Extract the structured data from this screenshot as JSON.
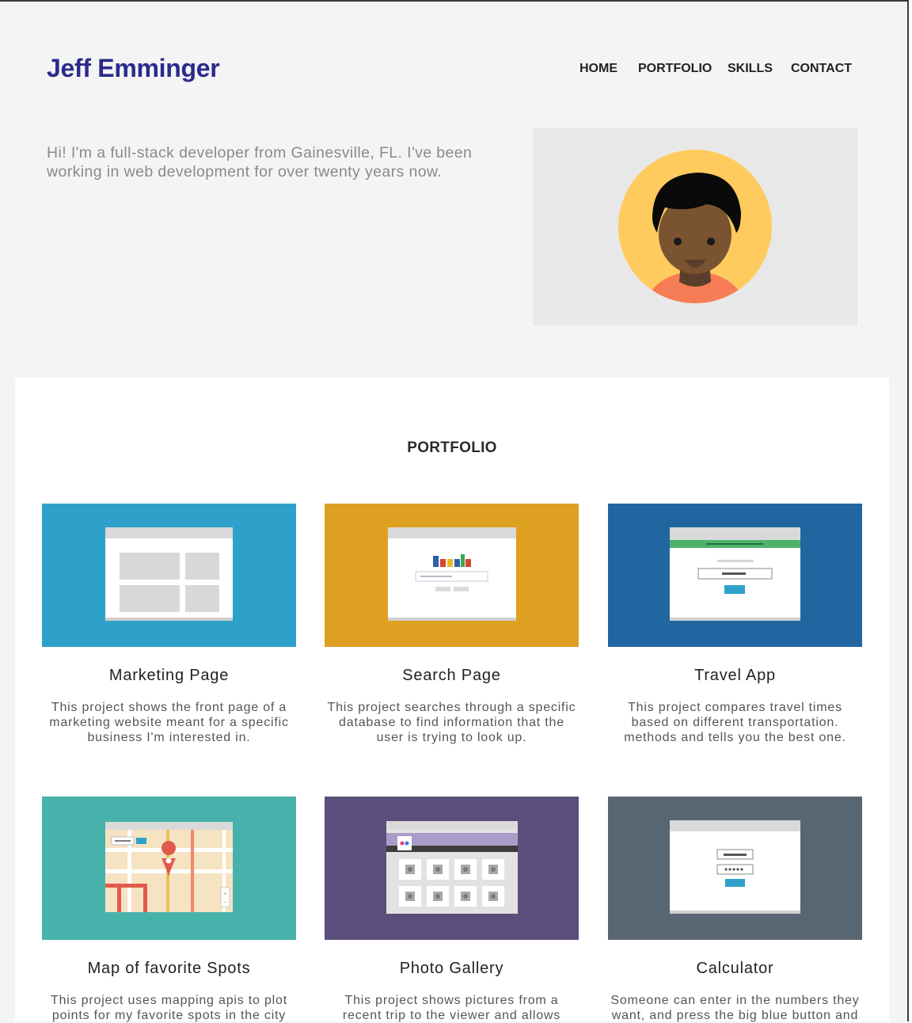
{
  "header": {
    "brand": "Jeff Emminger",
    "nav": [
      {
        "label": "HOME"
      },
      {
        "label": "PORTFOLIO"
      },
      {
        "label": "SKILLS"
      },
      {
        "label": "CONTACT"
      }
    ]
  },
  "hero": {
    "intro": "Hi! I'm a full-stack developer from Gainesville, FL. I've been working in web development for over twenty years now.",
    "avatar_icon": "person-avatar-icon"
  },
  "portfolio": {
    "title": "PORTFOLIO",
    "projects": [
      {
        "title": "Marketing Page",
        "description": "This project shows the front page of a marketing website meant for a specific business I'm interested in.",
        "color": "#2ea1cb",
        "icon": "marketing-page-thumbnail"
      },
      {
        "title": "Search Page",
        "description": "This project searches through a specific database to find information that the user is trying to look up.",
        "color": "#dea021",
        "icon": "search-page-thumbnail"
      },
      {
        "title": "Travel App",
        "description": "This project compares travel times based on different transportation. methods and tells you the best one.",
        "color": "#2166a1",
        "icon": "travel-app-thumbnail"
      },
      {
        "title": "Map of favorite Spots",
        "description": "This project uses mapping apis to plot points for my favorite spots in the city",
        "color": "#47b2ab",
        "icon": "map-thumbnail"
      },
      {
        "title": "Photo Gallery",
        "description": "This project shows pictures from a recent trip to the viewer and allows",
        "color": "#5b4e7c",
        "icon": "photo-gallery-thumbnail"
      },
      {
        "title": "Calculator",
        "description": "Someone can enter in the numbers they want, and press the big blue button and",
        "color": "#586673",
        "icon": "calculator-thumbnail"
      }
    ]
  },
  "colors": {
    "brand": "#2b2b8c",
    "page_background": "#f4f4f4",
    "avatar_circle": "#ffcb5e",
    "avatar_shirt": "#f57c55"
  }
}
